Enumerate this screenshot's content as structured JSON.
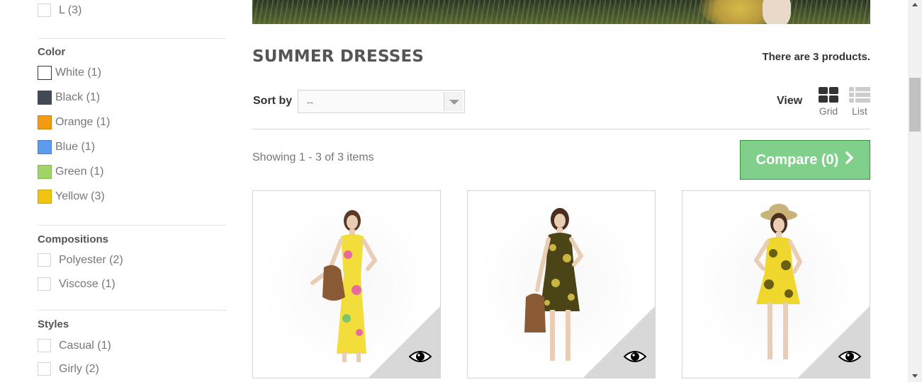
{
  "sidebar": {
    "size_items": [
      {
        "label": "L (3)"
      }
    ],
    "color_title": "Color",
    "colors": [
      {
        "label": "White (1)",
        "hex": "#ffffff"
      },
      {
        "label": "Black (1)",
        "hex": "#434a54"
      },
      {
        "label": "Orange (1)",
        "hex": "#f39c11"
      },
      {
        "label": "Blue (1)",
        "hex": "#5d9cec"
      },
      {
        "label": "Green (1)",
        "hex": "#a0d468"
      },
      {
        "label": "Yellow (3)",
        "hex": "#f1c40f"
      }
    ],
    "compositions_title": "Compositions",
    "compositions": [
      {
        "label": "Polyester (2)"
      },
      {
        "label": "Viscose (1)"
      }
    ],
    "styles_title": "Styles",
    "styles": [
      {
        "label": "Casual (1)"
      },
      {
        "label": "Girly (2)"
      }
    ]
  },
  "main": {
    "category_title": "SUMMER DRESSES",
    "product_count": "There are 3 products.",
    "sort_label": "Sort by",
    "sort_value": "--",
    "view_label": "View",
    "view_grid": "Grid",
    "view_list": "List",
    "showing": "Showing 1 - 3 of 3 items",
    "compare_label": "Compare (0)",
    "compare_icon": "chevron-right-icon"
  },
  "products": [
    {
      "dress_color": "#f3dd3a",
      "pattern_color": "#e86aa0",
      "has_bag": true,
      "hat": false
    },
    {
      "dress_color": "#4a4416",
      "pattern_color": "#c9b640",
      "has_bag": true,
      "hat": false
    },
    {
      "dress_color": "#f0d72e",
      "pattern_color": "#6b5d12",
      "has_bag": false,
      "hat": true
    }
  ],
  "colors": {
    "accent_green": "#80cf8a",
    "text": "#777777",
    "heading": "#555555"
  }
}
